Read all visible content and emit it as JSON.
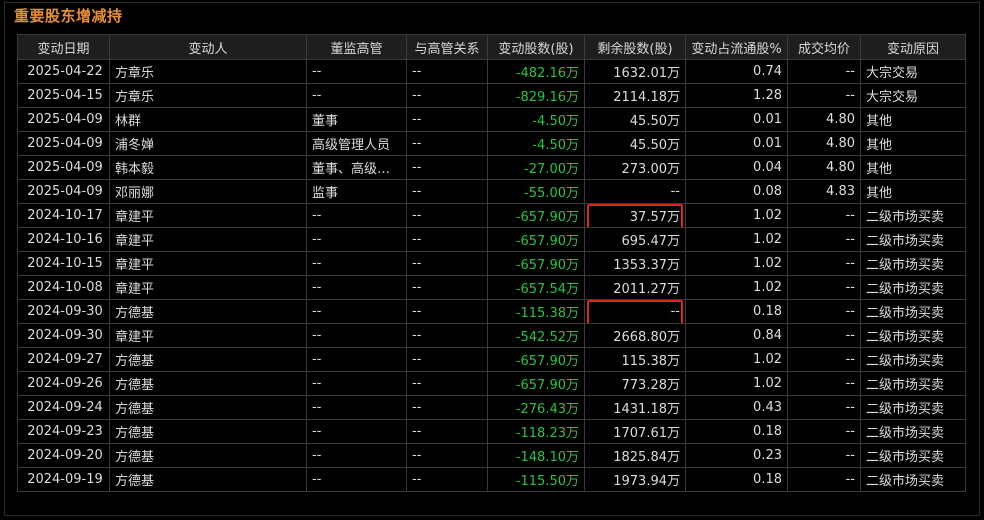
{
  "title": "重要股东增减持",
  "colors": {
    "title": "#e8902c",
    "negative": "#27c447",
    "highlight": "#e0231b"
  },
  "table": {
    "headers": [
      "变动日期",
      "变动人",
      "董监高管",
      "与高管关系",
      "变动股数(股)",
      "剩余股数(股)",
      "变动占流通股%",
      "成交均价",
      "变动原因"
    ],
    "rows": [
      [
        "2025-04-22",
        "方章乐",
        "--",
        "--",
        "-482.16万",
        "1632.01万",
        "0.74",
        "--",
        "大宗交易"
      ],
      [
        "2025-04-15",
        "方章乐",
        "--",
        "--",
        "-829.16万",
        "2114.18万",
        "1.28",
        "--",
        "大宗交易"
      ],
      [
        "2025-04-09",
        "林群",
        "董事",
        "--",
        "-4.50万",
        "45.50万",
        "0.01",
        "4.80",
        "其他"
      ],
      [
        "2025-04-09",
        "浦冬婵",
        "高级管理人员",
        "--",
        "-4.50万",
        "45.50万",
        "0.01",
        "4.80",
        "其他"
      ],
      [
        "2025-04-09",
        "韩本毅",
        "董事、高级管理人员",
        "--",
        "-27.00万",
        "273.00万",
        "0.04",
        "4.80",
        "其他"
      ],
      [
        "2025-04-09",
        "邓丽娜",
        "监事",
        "--",
        "-55.00万",
        "--",
        "0.08",
        "4.83",
        "其他"
      ],
      [
        "2024-10-17",
        "章建平",
        "--",
        "--",
        "-657.90万",
        "37.57万",
        "1.02",
        "--",
        "二级市场买卖"
      ],
      [
        "2024-10-16",
        "章建平",
        "--",
        "--",
        "-657.90万",
        "695.47万",
        "1.02",
        "--",
        "二级市场买卖"
      ],
      [
        "2024-10-15",
        "章建平",
        "--",
        "--",
        "-657.90万",
        "1353.37万",
        "1.02",
        "--",
        "二级市场买卖"
      ],
      [
        "2024-10-08",
        "章建平",
        "--",
        "--",
        "-657.54万",
        "2011.27万",
        "1.02",
        "--",
        "二级市场买卖"
      ],
      [
        "2024-09-30",
        "方德基",
        "--",
        "--",
        "-115.38万",
        "--",
        "0.18",
        "--",
        "二级市场买卖"
      ],
      [
        "2024-09-30",
        "章建平",
        "--",
        "--",
        "-542.52万",
        "2668.80万",
        "0.84",
        "--",
        "二级市场买卖"
      ],
      [
        "2024-09-27",
        "方德基",
        "--",
        "--",
        "-657.90万",
        "115.38万",
        "1.02",
        "--",
        "二级市场买卖"
      ],
      [
        "2024-09-26",
        "方德基",
        "--",
        "--",
        "-657.90万",
        "773.28万",
        "1.02",
        "--",
        "二级市场买卖"
      ],
      [
        "2024-09-24",
        "方德基",
        "--",
        "--",
        "-276.43万",
        "1431.18万",
        "0.43",
        "--",
        "二级市场买卖"
      ],
      [
        "2024-09-23",
        "方德基",
        "--",
        "--",
        "-118.23万",
        "1707.61万",
        "0.18",
        "--",
        "二级市场买卖"
      ],
      [
        "2024-09-20",
        "方德基",
        "--",
        "--",
        "-148.10万",
        "1825.84万",
        "0.23",
        "--",
        "二级市场买卖"
      ],
      [
        "2024-09-19",
        "方德基",
        "--",
        "--",
        "-115.50万",
        "1973.94万",
        "0.18",
        "--",
        "二级市场买卖"
      ]
    ],
    "highlighted_cells": [
      [
        6,
        5
      ],
      [
        10,
        5
      ]
    ]
  }
}
